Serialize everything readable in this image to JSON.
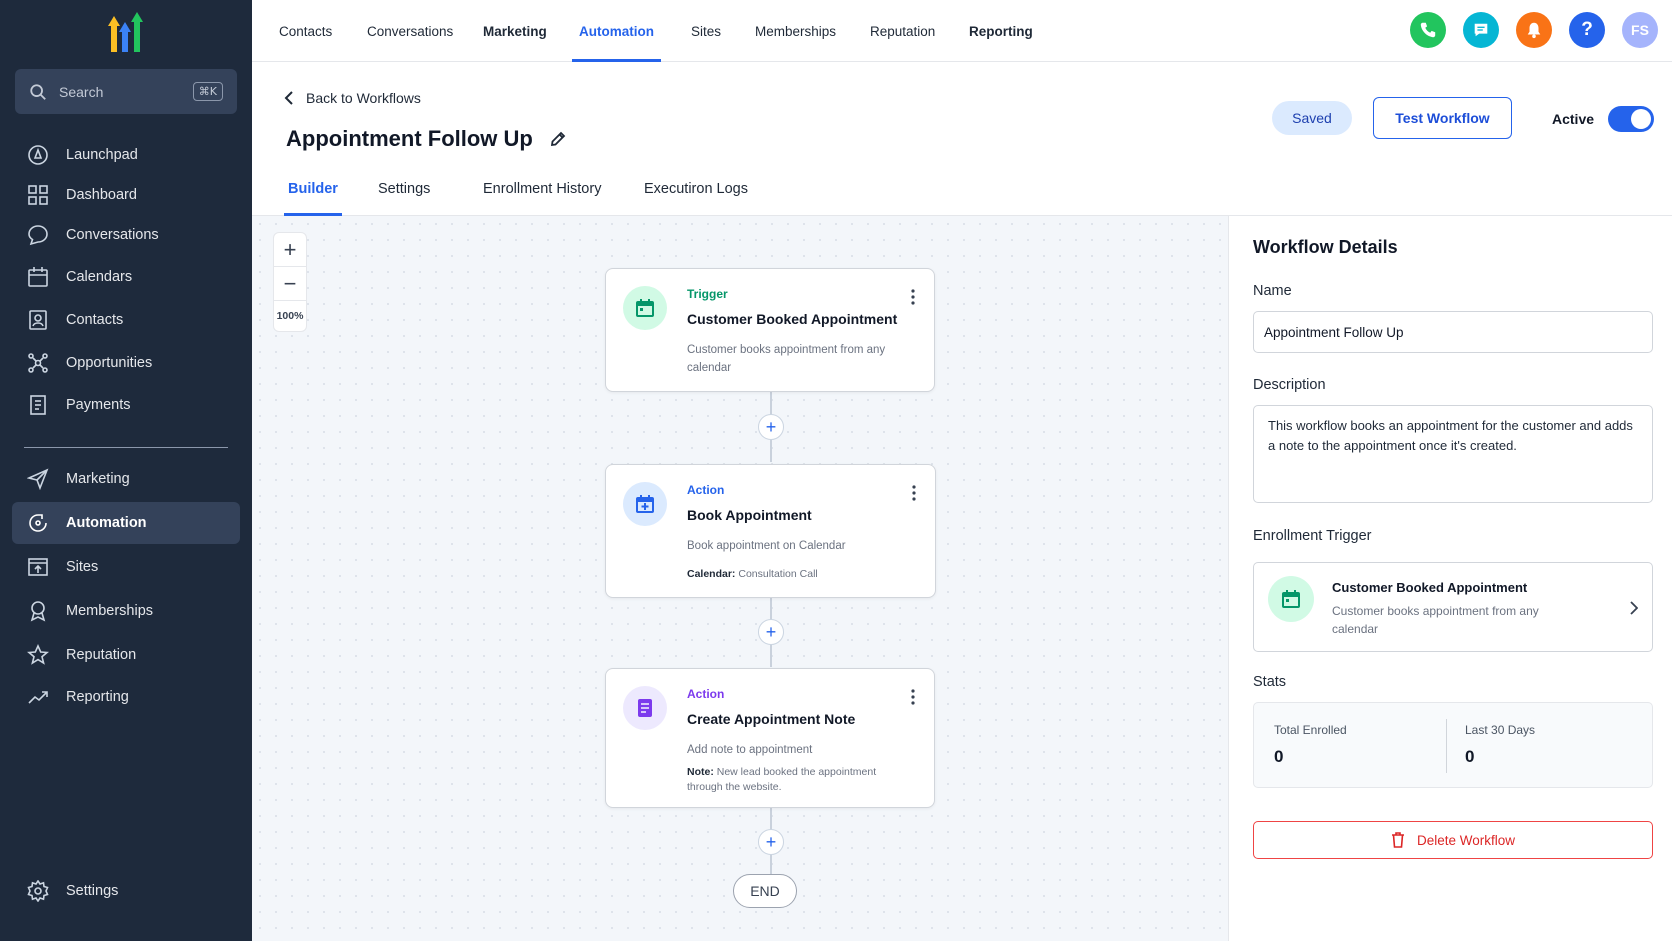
{
  "colors": {
    "sidebar_bg": "#1e2a3c",
    "accent": "#2563eb",
    "trigger_green": "#059669",
    "action_blue": "#2563eb",
    "action_purple": "#7c3aed",
    "danger": "#dc2626"
  },
  "sidebar": {
    "search": {
      "placeholder": "Search",
      "shortcut": "⌘K",
      "icon": "search-icon"
    },
    "items": [
      {
        "label": "Launchpad",
        "icon": "rocket-icon"
      },
      {
        "label": "Dashboard",
        "icon": "grid-icon"
      },
      {
        "label": "Conversations",
        "icon": "chat-icon"
      },
      {
        "label": "Calendars",
        "icon": "calendar-icon"
      },
      {
        "label": "Contacts",
        "icon": "contacts-icon"
      },
      {
        "label": "Opportunities",
        "icon": "network-icon"
      },
      {
        "label": "Payments",
        "icon": "receipt-icon"
      },
      {
        "label": "Marketing",
        "icon": "send-icon"
      },
      {
        "label": "Automation",
        "icon": "automation-icon",
        "active": true
      },
      {
        "label": "Sites",
        "icon": "sites-icon"
      },
      {
        "label": "Memberships",
        "icon": "badge-icon"
      },
      {
        "label": "Reputation",
        "icon": "star-icon"
      },
      {
        "label": "Reporting",
        "icon": "trend-icon"
      }
    ],
    "settings": {
      "label": "Settings",
      "icon": "gear-icon"
    }
  },
  "topnav": {
    "items": [
      "Contacts",
      "Conversations",
      "Marketing",
      "Automation",
      "Sites",
      "Memberships",
      "Reputation",
      "Reporting"
    ],
    "active": "Automation",
    "avatar_initials": "FS",
    "help_glyph": "?"
  },
  "header": {
    "back_label": "Back to Workflows",
    "title": "Appointment Follow Up",
    "tabs": [
      "Builder",
      "Settings",
      "Enrollment History",
      "Executiron Logs"
    ],
    "active_tab": "Builder",
    "saved_label": "Saved",
    "test_label": "Test Workflow",
    "active_label": "Active",
    "active_on": true
  },
  "canvas": {
    "zoom_in": "+",
    "zoom_out": "−",
    "zoom_level": "100%",
    "plus_glyph": "+",
    "nodes": [
      {
        "type": "Trigger",
        "title": "Customer Booked Appointment",
        "description": "Customer books appointment from any calendar",
        "icon": "calendar-icon"
      },
      {
        "type": "Action",
        "title": "Book Appointment",
        "description": "Book appointment on Calendar",
        "detail_label": "Calendar:",
        "detail_value": " Consultation Call",
        "icon": "calendar-plus-icon"
      },
      {
        "type": "Action",
        "title": "Create Appointment Note",
        "description": "Add note to appointment",
        "detail_label": "Note:",
        "detail_value": " New lead booked the appointment through the website.",
        "icon": "note-icon"
      }
    ],
    "end_label": "END"
  },
  "panel": {
    "title": "Workflow Details",
    "name_label": "Name",
    "name_value": "Appointment Follow Up",
    "description_label": "Description",
    "description_value": "This workflow books an appointment for the customer and adds a note to the appointment once it's created.",
    "trigger_label": "Enrollment Trigger",
    "trigger_title": "Customer Booked Appointment",
    "trigger_desc": "Customer books appointment from any calendar",
    "stats_label": "Stats",
    "total_enrolled_label": "Total Enrolled",
    "total_enrolled_value": "0",
    "last30_label": "Last 30 Days",
    "last30_value": "0",
    "delete_label": "Delete Workflow"
  }
}
